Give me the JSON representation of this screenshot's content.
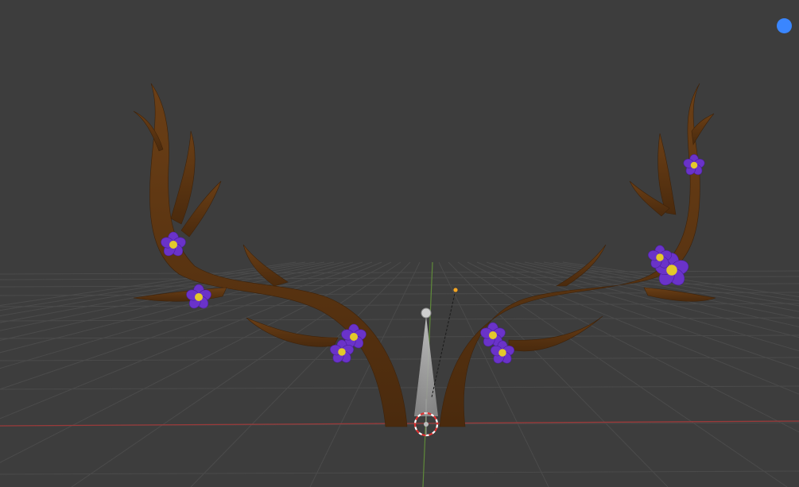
{
  "viewport": {
    "background_color": "#3d3d3d",
    "grid_color": "#4b4b4b",
    "x_axis_color": "#9a3a3a",
    "y_axis_color": "#5f8a3a"
  },
  "model": {
    "antler_color": "#5a3411",
    "antler_highlight": "#7a4a1c",
    "flower_color": "#6a33c9",
    "flower_center_color": "#e3c92a"
  },
  "light": {
    "cone_color": "#a9a9a9",
    "target_color": "#f5a623"
  },
  "gizmo": {
    "icon": "blue-circle-icon",
    "color": "#3a86ff"
  }
}
